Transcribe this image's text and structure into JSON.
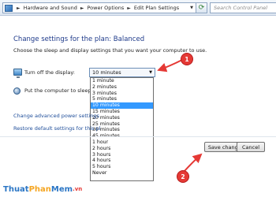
{
  "breadcrumb": {
    "items": [
      "Hardware and Sound",
      "Power Options",
      "Edit Plan Settings"
    ]
  },
  "search": {
    "placeholder": "Search Control Panel"
  },
  "page": {
    "title": "Change settings for the plan: Balanced",
    "subtitle": "Choose the sleep and display settings that you want your computer to use."
  },
  "settings": {
    "display": {
      "label": "Turn off the display:",
      "value": "10 minutes"
    },
    "sleep": {
      "label": "Put the computer to sleep:"
    }
  },
  "dropdown": {
    "options": [
      "1 minute",
      "2 minutes",
      "3 minutes",
      "5 minutes",
      "10 minutes",
      "15 minutes",
      "20 minutes",
      "25 minutes",
      "30 minutes",
      "45 minutes",
      "1 hour",
      "2 hours",
      "3 hours",
      "4 hours",
      "5 hours",
      "Never"
    ],
    "selected_index": 4
  },
  "links": {
    "advanced": "Change advanced power settings",
    "restore": "Restore default settings for this pl"
  },
  "buttons": {
    "save": "Save changes",
    "cancel": "Cancel"
  },
  "callouts": {
    "one": "1",
    "two": "2"
  },
  "watermark": {
    "a": "Thuat",
    "b": "Phan",
    "c": "Mem",
    "d": ".vn"
  },
  "colors": {
    "accent": "#3399ff",
    "callout": "#e53935",
    "link": "#1f4e9a"
  }
}
